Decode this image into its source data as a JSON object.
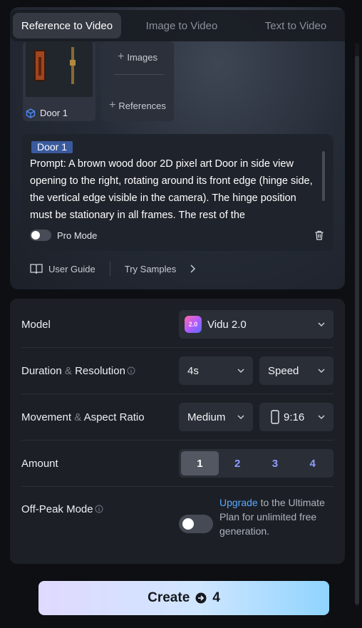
{
  "tabs": [
    {
      "label": "Reference to Video",
      "active": true
    },
    {
      "label": "Image to Video",
      "active": false
    },
    {
      "label": "Text to Video",
      "active": false
    }
  ],
  "reference": {
    "item_label": "Door 1",
    "add_images_label": "Images",
    "add_references_label": "References"
  },
  "prompt": {
    "tag": "Door 1",
    "text": "Prompt: A brown wood door 2D pixel art Door in side view opening to the right, rotating around its front edge (hinge side, the vertical edge visible in the camera). The hinge position must be stationary in all frames. The rest of the",
    "pro_mode_label": "Pro Mode"
  },
  "guide": {
    "user_guide_label": "User Guide",
    "try_samples_label": "Try Samples"
  },
  "settings": {
    "model_label": "Model",
    "model_value": "Vidu 2.0",
    "model_logo_text": "2.0",
    "duration_label_a": "Duration",
    "duration_label_amp": "&",
    "duration_label_b": "Resolution",
    "duration_value": "4s",
    "resolution_value": "Speed",
    "movement_label_a": "Movement",
    "movement_label_amp": "&",
    "movement_label_b": "Aspect Ratio",
    "movement_value": "Medium",
    "aspect_value": "9:16",
    "amount_label": "Amount",
    "amount_options": [
      "1",
      "2",
      "3",
      "4"
    ],
    "amount_selected": "1",
    "offpeak_label": "Off-Peak Mode",
    "upgrade_link": "Upgrade",
    "upgrade_text": " to the Ultimate Plan for unlimited free generation."
  },
  "create": {
    "label": "Create",
    "cost": "4"
  },
  "colors": {
    "accent_blue": "#5aa9ff",
    "amount_blue": "#8e9eff",
    "tag_blue": "#3a5a9e"
  }
}
